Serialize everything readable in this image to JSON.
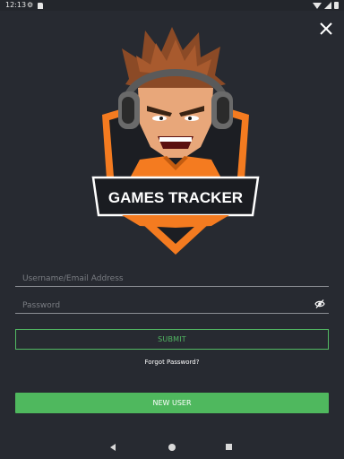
{
  "status_bar": {
    "time": "12:13"
  },
  "logo": {
    "text": "GAMES TRACKER"
  },
  "form": {
    "username_placeholder": "Username/Email Address",
    "password_placeholder": "Password",
    "submit_label": "SUBMIT",
    "forgot_label": "Forgot Password?",
    "new_user_label": "NEW USER"
  },
  "colors": {
    "background": "#272a31",
    "accent_green": "#4fb85e",
    "logo_orange": "#f47b20"
  },
  "icons": [
    "settings-gear-icon",
    "sd-card-icon",
    "wifi-icon",
    "signal-icon",
    "battery-icon",
    "close-icon",
    "eye-off-icon",
    "back-icon",
    "home-icon",
    "recents-icon"
  ]
}
